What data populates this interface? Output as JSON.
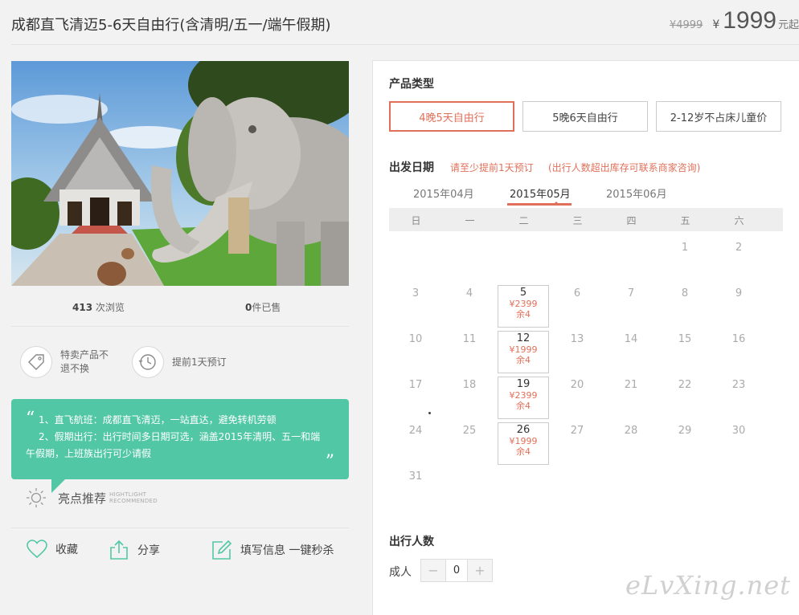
{
  "product": {
    "title": "成都直飞清迈5-6天自由行(含清明/五一/端午假期)",
    "old_price": "¥4999",
    "currency": "¥",
    "price": "1999",
    "price_unit": "元起"
  },
  "stats": {
    "views_num": "413",
    "views_label": " 次浏览",
    "sold_num": "0",
    "sold_label": "件已售"
  },
  "features": [
    {
      "icon": "tag-icon",
      "text": "特卖产品不退不换"
    },
    {
      "icon": "clock-icon",
      "text": "提前1天预订"
    }
  ],
  "highlight": {
    "line1": "1、直飞航班：成都直飞清迈，一站直达，避免转机劳顿",
    "line2": "2、假期出行：出行时间多日期可选，涵盖2015年清明、五一和端",
    "line3": "午假期，上班族出行可少请假",
    "quote_open": "“",
    "quote_close": "”",
    "title": "亮点推荐",
    "sub1": "HIGHTLIGHT",
    "sub2": "RECOMMENDED"
  },
  "actions": {
    "favorite": "收藏",
    "share": "分享",
    "fill": "填写信息 一键秒杀"
  },
  "panel": {
    "type_title": "产品类型",
    "types": [
      "4晚5天自由行",
      "5晚6天自由行",
      "2-12岁不占床儿童价"
    ],
    "date_title": "出发日期",
    "notice1": "请至少提前1天预订",
    "notice2": "(出行人数超出库存可联系商家咨询)",
    "months": [
      "2015年04月",
      "2015年05月",
      "2015年06月"
    ],
    "weekdays": [
      "日",
      "一",
      "二",
      "三",
      "四",
      "五",
      "六"
    ],
    "rows": [
      [
        "",
        "",
        "",
        "",
        "",
        "1",
        "2"
      ],
      [
        "3",
        "4",
        "5",
        "6",
        "7",
        "8",
        "9"
      ],
      [
        "10",
        "11",
        "12",
        "13",
        "14",
        "15",
        "16"
      ],
      [
        "17",
        "18",
        "19",
        "20",
        "21",
        "22",
        "23"
      ],
      [
        "24",
        "25",
        "26",
        "27",
        "28",
        "29",
        "30"
      ],
      [
        "31",
        "",
        "",
        "",
        "",
        "",
        ""
      ]
    ],
    "available": [
      {
        "day": "5",
        "price": "¥2399",
        "stock": "余4"
      },
      {
        "day": "12",
        "price": "¥1999",
        "stock": "余4"
      },
      {
        "day": "19",
        "price": "¥2399",
        "stock": "余4"
      },
      {
        "day": "26",
        "price": "¥1999",
        "stock": "余4"
      }
    ],
    "travelers_title": "出行人数",
    "adult_label": "成人",
    "adult_count": "0",
    "minus": "−",
    "plus": "+"
  },
  "watermark": "eLvXing.net",
  "colors": {
    "accent": "#e0705a",
    "teal": "#52c7a5"
  }
}
